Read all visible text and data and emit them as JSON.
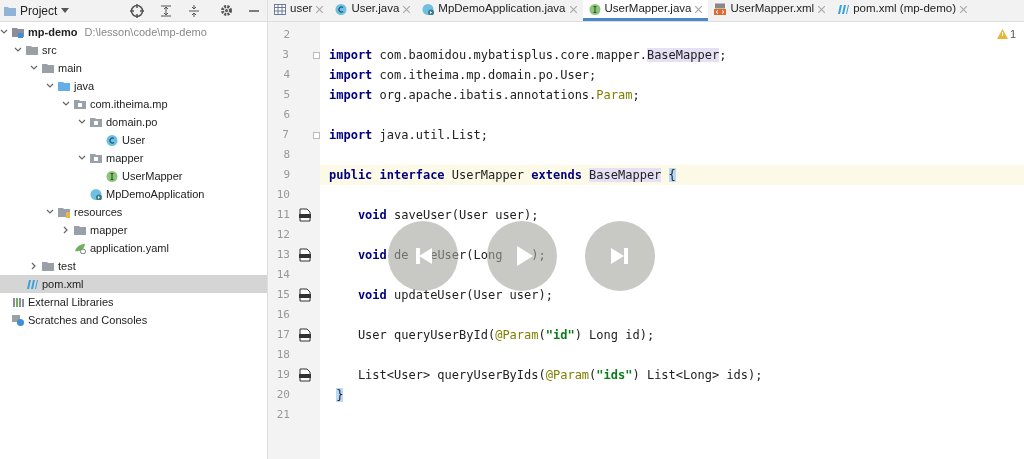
{
  "project_panel": {
    "title": "Project"
  },
  "tree": [
    {
      "label": "mp-demo",
      "path": "D:\\lesson\\code\\mp-demo",
      "kind": "module",
      "expanded": true,
      "selected": false,
      "children": [
        {
          "label": "src",
          "kind": "folder",
          "expanded": true,
          "selected": false,
          "children": [
            {
              "label": "main",
              "kind": "folder",
              "expanded": true,
              "selected": false,
              "children": [
                {
                  "label": "java",
                  "kind": "source",
                  "expanded": true,
                  "selected": false,
                  "children": [
                    {
                      "label": "com.itheima.mp",
                      "kind": "package",
                      "expanded": true,
                      "selected": false,
                      "children": [
                        {
                          "label": "domain.po",
                          "kind": "package",
                          "expanded": true,
                          "selected": false,
                          "children": [
                            {
                              "label": "User",
                              "kind": "class",
                              "selected": false
                            }
                          ]
                        },
                        {
                          "label": "mapper",
                          "kind": "package",
                          "expanded": true,
                          "selected": false,
                          "children": [
                            {
                              "label": "UserMapper",
                              "kind": "interface",
                              "selected": false
                            }
                          ]
                        },
                        {
                          "label": "MpDemoApplication",
                          "kind": "app",
                          "selected": false
                        }
                      ]
                    }
                  ]
                },
                {
                  "label": "resources",
                  "kind": "resources",
                  "expanded": true,
                  "selected": false,
                  "children": [
                    {
                      "label": "mapper",
                      "kind": "folder",
                      "expanded": false,
                      "selected": false
                    },
                    {
                      "label": "application.yaml",
                      "kind": "yaml",
                      "selected": false
                    }
                  ]
                }
              ]
            },
            {
              "label": "test",
              "kind": "folder",
              "expanded": false,
              "selected": false
            }
          ]
        },
        {
          "label": "pom.xml",
          "kind": "maven",
          "selected": true
        }
      ]
    },
    {
      "label": "External Libraries",
      "kind": "libraries",
      "selected": false
    },
    {
      "label": "Scratches and Consoles",
      "kind": "scratches",
      "selected": false
    }
  ],
  "tabs": [
    {
      "label": "user",
      "kind": "table",
      "selected": false
    },
    {
      "label": "User.java",
      "kind": "class",
      "selected": false
    },
    {
      "label": "MpDemoApplication.java",
      "kind": "app",
      "selected": false
    },
    {
      "label": "UserMapper.java",
      "kind": "interface",
      "selected": true
    },
    {
      "label": "UserMapper.xml",
      "kind": "xml",
      "selected": false
    },
    {
      "label": "pom.xml (mp-demo)",
      "kind": "maven",
      "selected": false
    }
  ],
  "warnings": {
    "count": "1"
  },
  "code_lines": [
    {
      "number": "2",
      "current": false
    },
    {
      "number": "3",
      "current": false,
      "fold": true,
      "tokens": [
        {
          "kind": "kw",
          "text": "import"
        },
        {
          "kind": "text",
          "text": " com.baomidou.mybatisplus.core.mapper."
        },
        {
          "kind": "ref",
          "text": "BaseMapper"
        },
        {
          "kind": "text",
          "text": ";"
        }
      ]
    },
    {
      "number": "4",
      "current": false,
      "tokens": [
        {
          "kind": "kw",
          "text": "import"
        },
        {
          "kind": "text",
          "text": " com.itheima.mp.domain.po.User;"
        }
      ]
    },
    {
      "number": "5",
      "current": false,
      "tokens": [
        {
          "kind": "kw",
          "text": "import"
        },
        {
          "kind": "text",
          "text": " org.apache.ibatis.annotations."
        },
        {
          "kind": "ann",
          "text": "Param"
        },
        {
          "kind": "text",
          "text": ";"
        }
      ]
    },
    {
      "number": "6",
      "current": false
    },
    {
      "number": "7",
      "current": false,
      "fold": true,
      "tokens": [
        {
          "kind": "kw",
          "text": "import"
        },
        {
          "kind": "text",
          "text": " java.util.List;"
        }
      ]
    },
    {
      "number": "8",
      "current": false
    },
    {
      "number": "9",
      "current": true,
      "tokens": [
        {
          "kind": "kw",
          "text": "public interface"
        },
        {
          "kind": "text",
          "text": " UserMapper "
        },
        {
          "kind": "kw",
          "text": "extends "
        },
        {
          "kind": "ref",
          "text": "BaseMapper"
        },
        {
          "kind": "brace",
          "text": "{"
        }
      ]
    },
    {
      "number": "10",
      "current": false
    },
    {
      "number": "11",
      "current": false,
      "xml_link": true,
      "tokens": [
        {
          "kind": "kw",
          "text": "    void"
        },
        {
          "kind": "text",
          "text": " saveUser(User user);"
        }
      ]
    },
    {
      "number": "12",
      "current": false
    },
    {
      "number": "13",
      "current": false,
      "xml_link": true,
      "tokens": [
        {
          "kind": "kw",
          "text": "    void"
        },
        {
          "kind": "text",
          "text": " de"
        },
        {
          "kind": "covered"
        },
        {
          "kind": "text",
          "text": "eUser(Long"
        },
        {
          "kind": "covered"
        },
        {
          "kind": "text",
          "text": ");"
        }
      ]
    },
    {
      "number": "14",
      "current": false
    },
    {
      "number": "15",
      "current": false,
      "xml_link": true,
      "tokens": [
        {
          "kind": "kw",
          "text": "    void"
        },
        {
          "kind": "text",
          "text": " updateUser(User user);"
        }
      ]
    },
    {
      "number": "16",
      "current": false
    },
    {
      "number": "17",
      "current": false,
      "xml_link": true,
      "tokens": [
        {
          "kind": "text",
          "text": "    User queryUserById("
        },
        {
          "kind": "ann",
          "text": "@Param"
        },
        {
          "kind": "text",
          "text": "("
        },
        {
          "kind": "str",
          "text": "\"id\""
        },
        {
          "kind": "text",
          "text": ") Long id);"
        }
      ]
    },
    {
      "number": "18",
      "current": false
    },
    {
      "number": "19",
      "current": false,
      "xml_link": true,
      "tokens": [
        {
          "kind": "text",
          "text": "    List<User> queryUserByIds("
        },
        {
          "kind": "ann",
          "text": "@Param"
        },
        {
          "kind": "text",
          "text": "("
        },
        {
          "kind": "str",
          "text": "\"ids\""
        },
        {
          "kind": "text",
          "text": ") List<Long> ids);"
        }
      ]
    },
    {
      "number": "20",
      "current": false,
      "tokens": [
        {
          "kind": "brace",
          "text": "}"
        }
      ]
    },
    {
      "number": "21",
      "current": false
    }
  ],
  "player_controls": [
    {
      "kind": "previous"
    },
    {
      "kind": "play"
    },
    {
      "kind": "next"
    }
  ]
}
